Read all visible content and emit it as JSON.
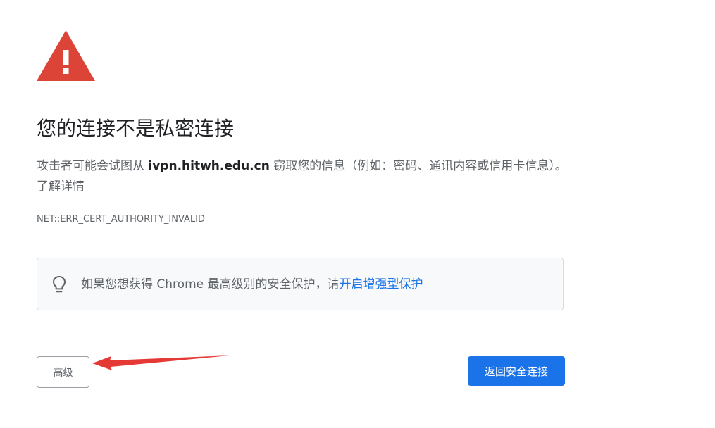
{
  "page": {
    "heading": "您的连接不是私密连接",
    "message": {
      "prefix": "攻击者可能会试图从 ",
      "host": "ivpn.hitwh.edu.cn",
      "suffix": " 窃取您的信息（例如：密码、通讯内容或信用卡信息）。",
      "learn_more": "了解详情"
    },
    "error_code": "NET::ERR_CERT_AUTHORITY_INVALID",
    "promo": {
      "icon": "lightbulb-icon",
      "text": "如果您想获得 Chrome 最高级别的安全保护，请",
      "link": "开启增强型保护"
    },
    "buttons": {
      "advanced": "高级",
      "back_to_safety": "返回安全连接"
    }
  },
  "colors": {
    "warning_red": "#db4437",
    "primary_blue": "#1a73e8",
    "annotation_arrow": "#e53935"
  }
}
